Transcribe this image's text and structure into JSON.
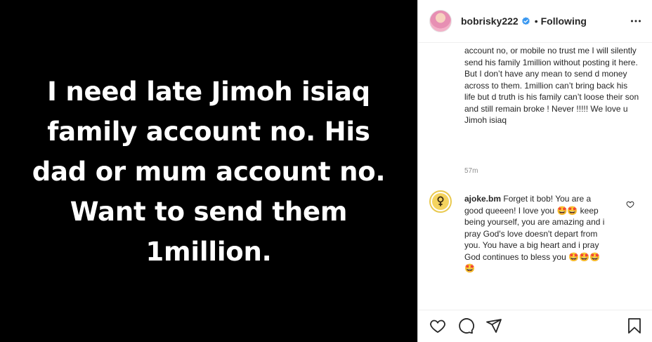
{
  "media": {
    "text": "I need late Jimoh isiaq\nfamily account no. His\ndad or mum account no.\nWant to send them\n1million."
  },
  "header": {
    "username": "bobrisky222",
    "separator": "•",
    "follow_state": "Following",
    "more_label": "•••"
  },
  "caption": {
    "text": "account no, or mobile no trust me I will silently send his family 1million without posting it here. But I don’t have any mean to send d money across to them. 1million can’t bring back his life but d truth is his family can’t loose their son and still remain broke ! Never !!!!! We love u Jimoh isiaq"
  },
  "timestamp": "57m",
  "comments": [
    {
      "user": "ajoke.bm",
      "text": " Forget it bob! You are a good queeen! I love you 🤩🤩 keep being yourself, you are amazing and i pray God's love doesn't depart from you. You have a big heart and i pray God continues to bless you 🤩🤩🤩 🤩"
    }
  ],
  "icons": {
    "like": "heart-icon",
    "comment": "comment-icon",
    "share": "paper-plane-icon",
    "save": "bookmark-icon",
    "verified": "verified-badge-icon",
    "more": "more-options-icon"
  },
  "colors": {
    "verified": "#3897f0",
    "text": "#262626",
    "muted": "#8e8e8e"
  }
}
